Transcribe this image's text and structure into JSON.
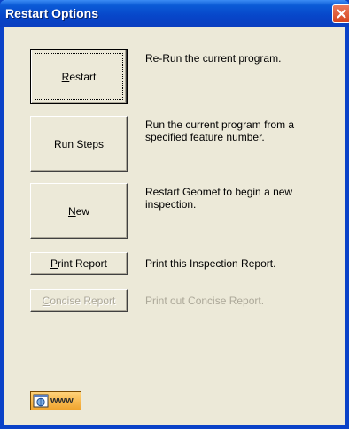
{
  "window": {
    "title": "Restart Options"
  },
  "options": [
    {
      "button_pre": "",
      "button_u": "R",
      "button_post": "estart",
      "description": "Re-Run the current program.",
      "enabled": true
    },
    {
      "button_pre": "R",
      "button_u": "u",
      "button_post": "n Steps",
      "description": "Run the current program from a specified feature number.",
      "enabled": true
    },
    {
      "button_pre": "",
      "button_u": "N",
      "button_post": "ew",
      "description": "Restart Geomet to begin a new inspection.",
      "enabled": true
    },
    {
      "button_pre": "",
      "button_u": "P",
      "button_post": "rint Report",
      "description": "Print this Inspection Report.",
      "enabled": true
    },
    {
      "button_pre": "",
      "button_u": "C",
      "button_post": "oncise Report",
      "description": "Print out Concise Report.",
      "enabled": false
    }
  ],
  "footer": {
    "www_label": "www",
    "icon": "globe-icon"
  },
  "colors": {
    "titlebar": "#0746c9",
    "dialog_bg": "#ece9d8",
    "disabled_text": "#aca899",
    "close_button": "#d7451e",
    "www_button": "#f0a42e"
  }
}
